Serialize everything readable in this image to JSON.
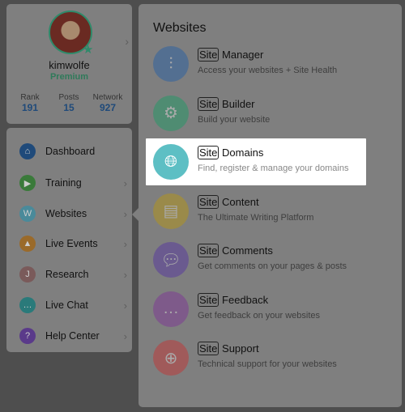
{
  "profile": {
    "username": "kimwolfe",
    "tier": "Premium",
    "stats": [
      {
        "label": "Rank",
        "value": "191"
      },
      {
        "label": "Posts",
        "value": "15"
      },
      {
        "label": "Network",
        "value": "927"
      }
    ]
  },
  "nav": [
    {
      "label": "Dashboard",
      "icon": "home-icon",
      "color": "#1f4a7a",
      "chevron": false
    },
    {
      "label": "Training",
      "icon": "play-icon",
      "color": "#3a7a3a",
      "chevron": true
    },
    {
      "label": "Websites",
      "icon": "website-icon",
      "color": "#4a8a9a",
      "chevron": true
    },
    {
      "label": "Live Events",
      "icon": "broadcast-icon",
      "color": "#9a6a2a",
      "chevron": true
    },
    {
      "label": "Research",
      "icon": "research-icon",
      "color": "#7a5a5a",
      "chevron": true
    },
    {
      "label": "Live Chat",
      "icon": "chat-icon",
      "color": "#2a7a7a",
      "chevron": true
    },
    {
      "label": "Help Center",
      "icon": "help-icon",
      "color": "#5a3a8a",
      "chevron": true
    }
  ],
  "main": {
    "title": "Websites",
    "site_prefix": "Site",
    "items": [
      {
        "name": "Manager",
        "desc": "Access your websites + Site Health",
        "icon": "sliders-icon",
        "color": "#536f91"
      },
      {
        "name": "Builder",
        "desc": "Build your website",
        "icon": "gear-icon",
        "color": "#4f8c72"
      },
      {
        "name": "Domains",
        "desc": "Find, register & manage your domains",
        "icon": "globe-icon",
        "color": "#5dbfc4",
        "highlighted": true
      },
      {
        "name": "Content",
        "desc": "The Ultimate Writing Platform",
        "icon": "document-icon",
        "color": "#9a8a4a"
      },
      {
        "name": "Comments",
        "desc": "Get comments on your pages & posts",
        "icon": "comments-icon",
        "color": "#6a5a8f"
      },
      {
        "name": "Feedback",
        "desc": "Get feedback on your websites",
        "icon": "feedback-icon",
        "color": "#7e5a8a"
      },
      {
        "name": "Support",
        "desc": "Technical support for your websites",
        "icon": "lifebuoy-icon",
        "color": "#a05a5a"
      }
    ]
  }
}
